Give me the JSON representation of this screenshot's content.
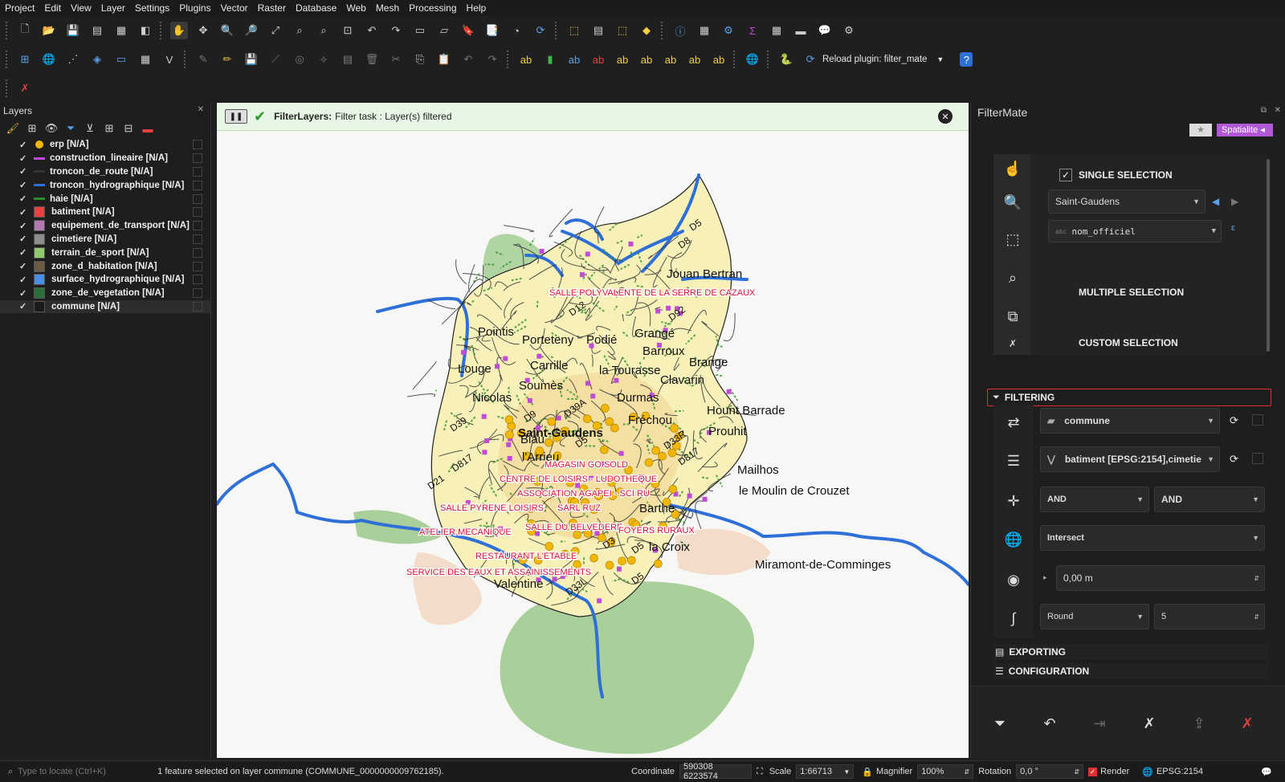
{
  "menubar": [
    "Project",
    "Edit",
    "View",
    "Layer",
    "Settings",
    "Plugins",
    "Vector",
    "Raster",
    "Database",
    "Web",
    "Mesh",
    "Processing",
    "Help"
  ],
  "toolbar": {
    "reload_plugin_label": "Reload plugin: filter_mate"
  },
  "layers_panel": {
    "title": "Layers",
    "items": [
      {
        "name": "erp [N/A]",
        "symbol": "#f2b705",
        "shape": "dot"
      },
      {
        "name": "construction_lineaire [N/A]",
        "symbol": "#c04bd6",
        "shape": "line"
      },
      {
        "name": "troncon_de_route [N/A]",
        "symbol": "#333333",
        "shape": "line"
      },
      {
        "name": "troncon_hydrographique [N/A]",
        "symbol": "#2f6fd8",
        "shape": "line"
      },
      {
        "name": "haie [N/A]",
        "symbol": "#2a8c2a",
        "shape": "line"
      },
      {
        "name": "batiment [N/A]",
        "symbol": "#e64040",
        "shape": "box"
      },
      {
        "name": "equipement_de_transport [N/A]",
        "symbol": "#b07ab0",
        "shape": "box"
      },
      {
        "name": "cimetiere [N/A]",
        "symbol": "#8c8c8c",
        "shape": "box"
      },
      {
        "name": "terrain_de_sport [N/A]",
        "symbol": "#8fc96b",
        "shape": "box"
      },
      {
        "name": "zone_d_habitation [N/A]",
        "symbol": "#6b5a44",
        "shape": "box"
      },
      {
        "name": "surface_hydrographique [N/A]",
        "symbol": "#4a90e2",
        "shape": "box"
      },
      {
        "name": "zone_de_vegetation [N/A]",
        "symbol": "#2c6e3a",
        "shape": "box"
      },
      {
        "name": "commune [N/A]",
        "symbol": "#1b1b1b",
        "shape": "box"
      }
    ]
  },
  "message_bar": {
    "title": "FilterLayers:",
    "text": "Filter task : Layer(s) filtered"
  },
  "map": {
    "places": [
      "Jouan Bertran",
      "Pointis",
      "Porteteny",
      "Podié",
      "Grangé",
      "Barroux",
      "Brange",
      "Louge",
      "Carrille",
      "la Tourasse",
      "Clavarin",
      "Soumès",
      "Nicolas",
      "Durmas",
      "Fréchou",
      "Hount Barrade",
      "Saint-Gaudens",
      "Prouhit",
      "Biau",
      "l'Arrieu",
      "Mailhos",
      "le Moulin de Crouzet",
      "Barthe",
      "la Croix",
      "Miramont-de-Comminges",
      "Valentine"
    ],
    "roads": [
      "D5",
      "D8",
      "D92",
      "D12",
      "D39",
      "D9",
      "D39A",
      "D5",
      "D33R",
      "D817",
      "D817",
      "D21",
      "D5",
      "D33L",
      "D3",
      "D5"
    ],
    "pois": [
      "SALLE POLYVALENTE DE LA SERRE DE CAZAUX",
      "MAGASIN GO SOLD",
      "CENTRE DE LOISIRS - LUDOTHEQUE",
      "ASSOCIATION AGAPEI - SCI RU",
      "SALLE PYRENE LOISIRS",
      "SARL RUZ",
      "SALLE DU BELVEDERE",
      "ATELIER MECANIQUE",
      "FOYERS RURAUX",
      "RESTAURANT L'ETABLE",
      "SERVICE DES EAUX ET ASSAINISSEMENTS"
    ]
  },
  "filtermate": {
    "title": "FilterMate",
    "badge": "Spatialite",
    "single_selection": "SINGLE SELECTION",
    "selected_feature": "Saint-Gaudens",
    "field": "nom_officiel",
    "multiple_selection": "MULTIPLE SELECTION",
    "custom_selection": "CUSTOM SELECTION",
    "filtering": "FILTERING",
    "source_layer": "commune",
    "target_layers": "batiment [EPSG:2154],cimetie",
    "combine_op1": "AND",
    "combine_op2": "AND",
    "predicate": "Intersect",
    "buffer": "0,00 m",
    "buffer_type": "Round",
    "segments": "5",
    "exporting": "EXPORTING",
    "configuration": "CONFIGURATION"
  },
  "statusbar": {
    "locate_placeholder": "Type to locate (Ctrl+K)",
    "message": "1 feature selected on layer commune (COMMUNE_0000000009762185).",
    "coordinate_label": "Coordinate",
    "coordinate": "590308 6223574",
    "scale_label": "Scale",
    "scale": "1:66713",
    "magnifier_label": "Magnifier",
    "magnifier": "100%",
    "rotation_label": "Rotation",
    "rotation": "0,0 °",
    "render_label": "Render",
    "crs": "EPSG:2154"
  }
}
